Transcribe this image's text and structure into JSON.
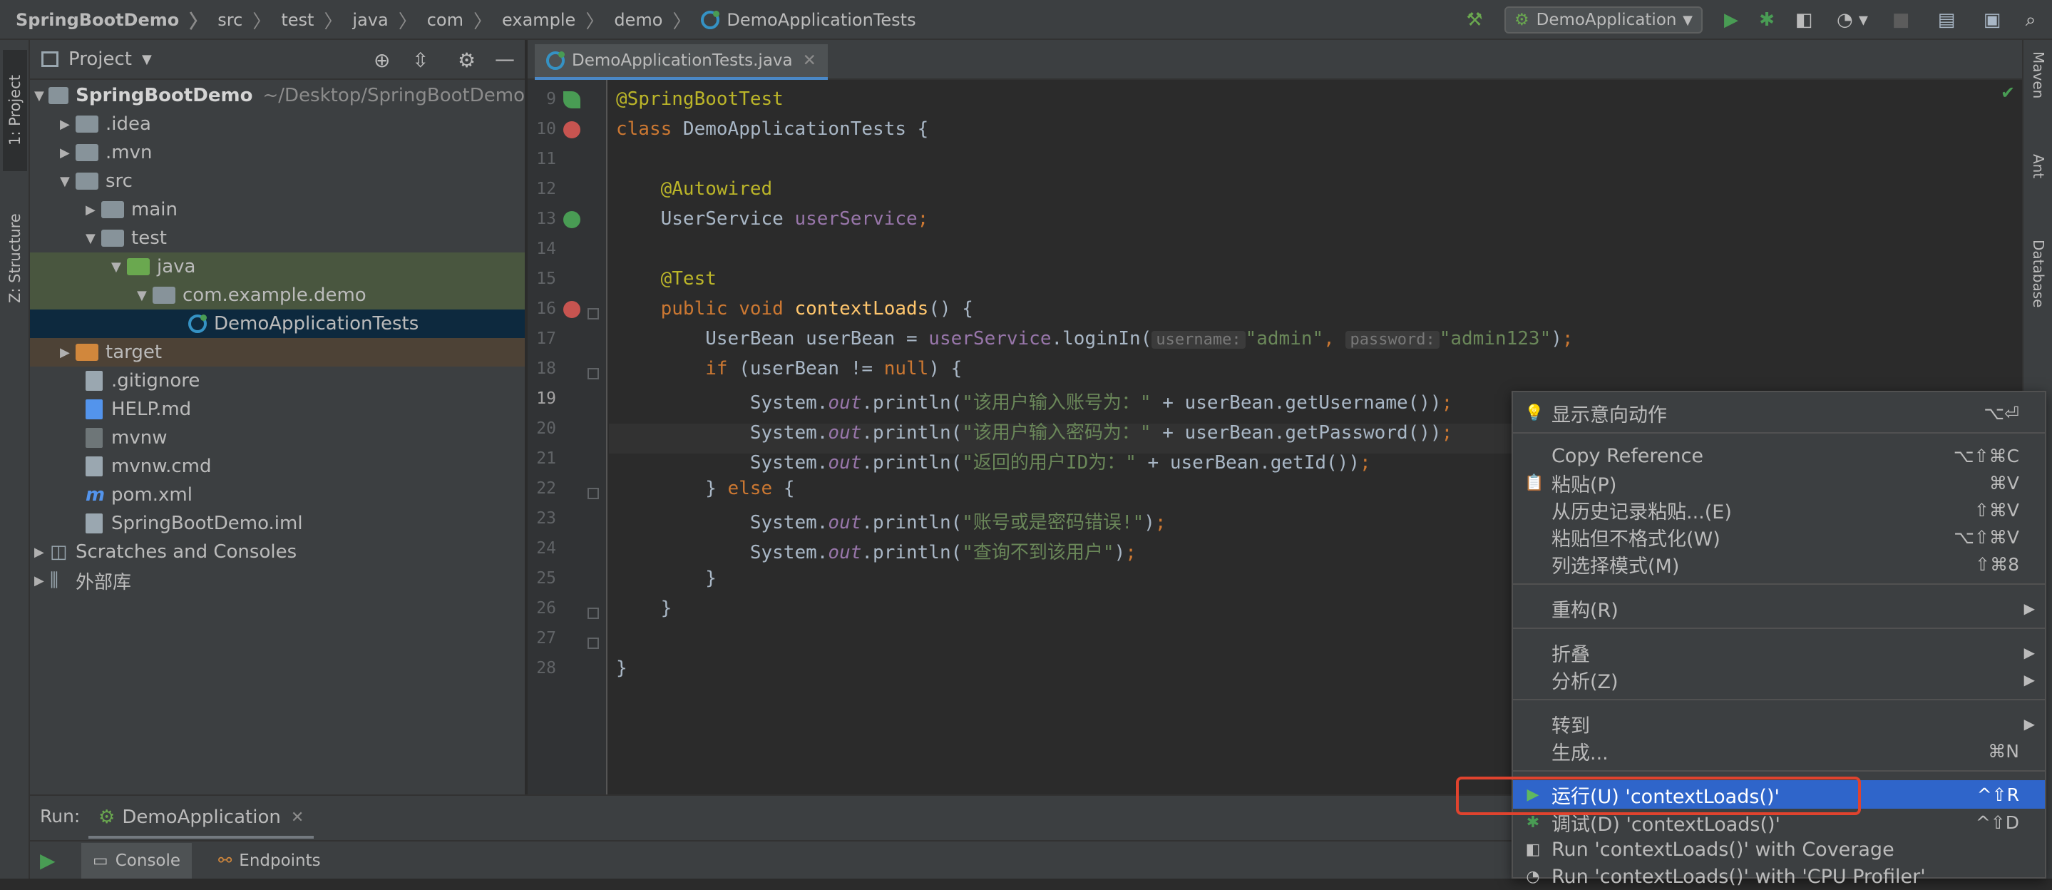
{
  "breadcrumb": {
    "items": [
      "SpringBootDemo",
      "src",
      "test",
      "java",
      "com",
      "example",
      "demo",
      "DemoApplicationTests"
    ]
  },
  "toolbar": {
    "run_config": "DemoApplication",
    "icons": [
      "hammer-icon",
      "run-icon",
      "debug-icon",
      "coverage-icon",
      "profiler-icon",
      "stop-icon",
      "project-structure-icon",
      "layout-icon",
      "search-icon"
    ]
  },
  "left_strip": {
    "project_tab": "1: Project",
    "structure_tab": "Z: Structure"
  },
  "right_strip": {
    "maven_tab": "Maven",
    "ant_tab": "Ant",
    "database_tab": "Database"
  },
  "project": {
    "header": "Project",
    "root_name": "SpringBootDemo",
    "root_path": "~/Desktop/SpringBootDemo",
    "items": [
      ".idea",
      ".mvn",
      "src",
      "main",
      "test",
      "java",
      "com.example.demo",
      "DemoApplicationTests",
      "target",
      ".gitignore",
      "HELP.md",
      "mvnw",
      "mvnw.cmd",
      "pom.xml",
      "SpringBootDemo.iml",
      "Scratches and Consoles",
      "外部库"
    ]
  },
  "editor": {
    "tab_label": "DemoApplicationTests.java",
    "line_numbers": [
      "9",
      "10",
      "11",
      "12",
      "13",
      "14",
      "15",
      "16",
      "17",
      "18",
      "19",
      "20",
      "21",
      "22",
      "23",
      "24",
      "25",
      "26",
      "27",
      "28"
    ],
    "hint_username": "username:",
    "hint_password": "password:",
    "str_admin": "\"admin\"",
    "str_admin123": "\"admin123\"",
    "str_username": "\"该用户输入账号为：\"",
    "str_password": "\"该用户输入密码为：\"",
    "str_id": "\"返回的用户ID为：\"",
    "str_error": "\"账号或是密码错误!\"",
    "str_notfound": "\"查询不到该用户\""
  },
  "run": {
    "label": "Run:",
    "config_tab": "DemoApplication",
    "console_tab": "Console",
    "endpoints_tab": "Endpoints"
  },
  "context_menu": {
    "items": [
      {
        "label": "显示意向动作",
        "shortcut": "⌥⏎"
      },
      {
        "label": "Copy Reference",
        "shortcut": "⌥⇧⌘C"
      },
      {
        "label": "粘贴(P)",
        "shortcut": "⌘V"
      },
      {
        "label": "从历史记录粘贴...(E)",
        "shortcut": "⇧⌘V"
      },
      {
        "label": "粘贴但不格式化(W)",
        "shortcut": "⌥⇧⌘V"
      },
      {
        "label": "列选择模式(M)",
        "shortcut": "⇧⌘8"
      },
      {
        "label": "重构(R)",
        "shortcut": ""
      },
      {
        "label": "折叠",
        "shortcut": ""
      },
      {
        "label": "分析(Z)",
        "shortcut": ""
      },
      {
        "label": "转到",
        "shortcut": ""
      },
      {
        "label": "生成...",
        "shortcut": "⌘N"
      },
      {
        "label": "运行(U) 'contextLoads()'",
        "shortcut": "^⇧R"
      },
      {
        "label": "调试(D) 'contextLoads()'",
        "shortcut": "^⇧D"
      },
      {
        "label": "Run 'contextLoads()' with Coverage",
        "shortcut": ""
      },
      {
        "label": "Run 'contextLoads()' with 'CPU Profiler'",
        "shortcut": ""
      }
    ]
  },
  "colors": {
    "selection": "#2f65ca",
    "highlight_box": "#e0432e",
    "run_green": "#499c54"
  }
}
